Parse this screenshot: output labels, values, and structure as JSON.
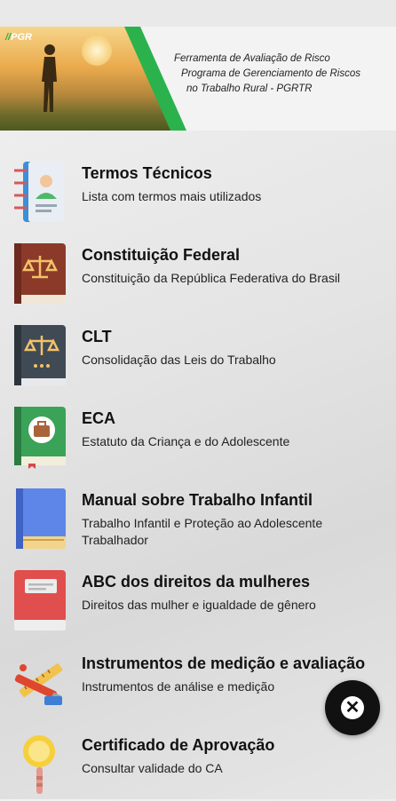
{
  "banner": {
    "logo_text": "PGR",
    "line1": "Ferramenta de Avaliação de Risco",
    "line2": "Programa de Gerenciamento de Riscos",
    "line3": "no Trabalho Rural - PGRTR",
    "accent_color": "#2bb24c"
  },
  "items": [
    {
      "title": "Termos Técnicos",
      "subtitle": "Lista com termos mais utilizados",
      "icon": "contact-notebook-icon"
    },
    {
      "title": "Constituição Federal",
      "subtitle": "Constituição da República Federativa do Brasil",
      "icon": "scales-book-icon"
    },
    {
      "title": "CLT",
      "subtitle": "Consolidação das Leis do Trabalho",
      "icon": "scales-book-icon"
    },
    {
      "title": "ECA",
      "subtitle": "Estatuto da Criança e do Adolescente",
      "icon": "briefcase-book-icon"
    },
    {
      "title": "Manual sobre Trabalho Infantil",
      "subtitle": "Trabalho Infantil e Proteção ao Adolescente Trabalhador",
      "icon": "blue-book-icon"
    },
    {
      "title": "ABC dos direitos da mulheres",
      "subtitle": "Direitos das mulher e igualdade de gênero",
      "icon": "red-book-icon"
    },
    {
      "title": "Instrumentos de medição e avaliação",
      "subtitle": "Instrumentos de análise e medição",
      "icon": "tools-icon"
    },
    {
      "title": "Certificado de Aprovação",
      "subtitle": "Consultar validade do CA",
      "icon": "magnifier-icon"
    }
  ],
  "fab": {
    "icon": "close-icon",
    "symbol": "✕"
  }
}
